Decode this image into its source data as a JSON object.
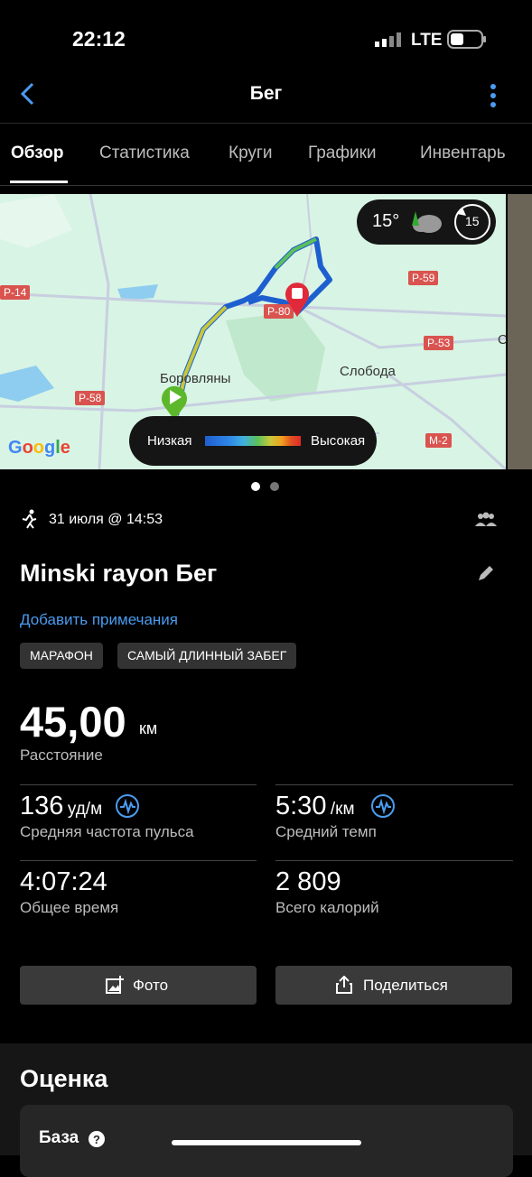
{
  "status": {
    "time": "22:12",
    "network": "LTE"
  },
  "header": {
    "title": "Бег"
  },
  "tabs": [
    "Обзор",
    "Статистика",
    "Круги",
    "Графики",
    "Инвентарь"
  ],
  "map": {
    "weather": {
      "temp": "15°",
      "wind": "15"
    },
    "labels": {
      "town1": "Боровляны",
      "town2": "Слобода",
      "town3": "С"
    },
    "roads": [
      "Р-14",
      "Р-59",
      "Р-80",
      "Р-53",
      "Р-58",
      "М-2"
    ],
    "google": "Google",
    "legend": {
      "low": "Низкая",
      "high": "Высокая"
    }
  },
  "activity": {
    "date": "31 июля @ 14:53",
    "title": "Minski rayon Бег",
    "add_notes": "Добавить примечания",
    "badges": [
      "МАРАФОН",
      "САМЫЙ ДЛИННЫЙ ЗАБЕГ"
    ]
  },
  "stats": {
    "distance": {
      "value": "45,00",
      "unit": "км",
      "label": "Расстояние"
    },
    "avg_hr": {
      "value": "136",
      "unit": "уд/м",
      "label": "Средняя частота пульса"
    },
    "avg_pace": {
      "value": "5:30",
      "unit": "/км",
      "label": "Средний темп"
    },
    "total_time": {
      "value": "4:07:24",
      "label": "Общее время"
    },
    "calories": {
      "value": "2 809",
      "label": "Всего калорий"
    }
  },
  "buttons": {
    "photo": "Фото",
    "share": "Поделиться"
  },
  "rating": {
    "title": "Оценка",
    "base": "База"
  },
  "colors": {
    "accent": "#4a9cf0",
    "background": "#000000",
    "badge": "#333333"
  }
}
